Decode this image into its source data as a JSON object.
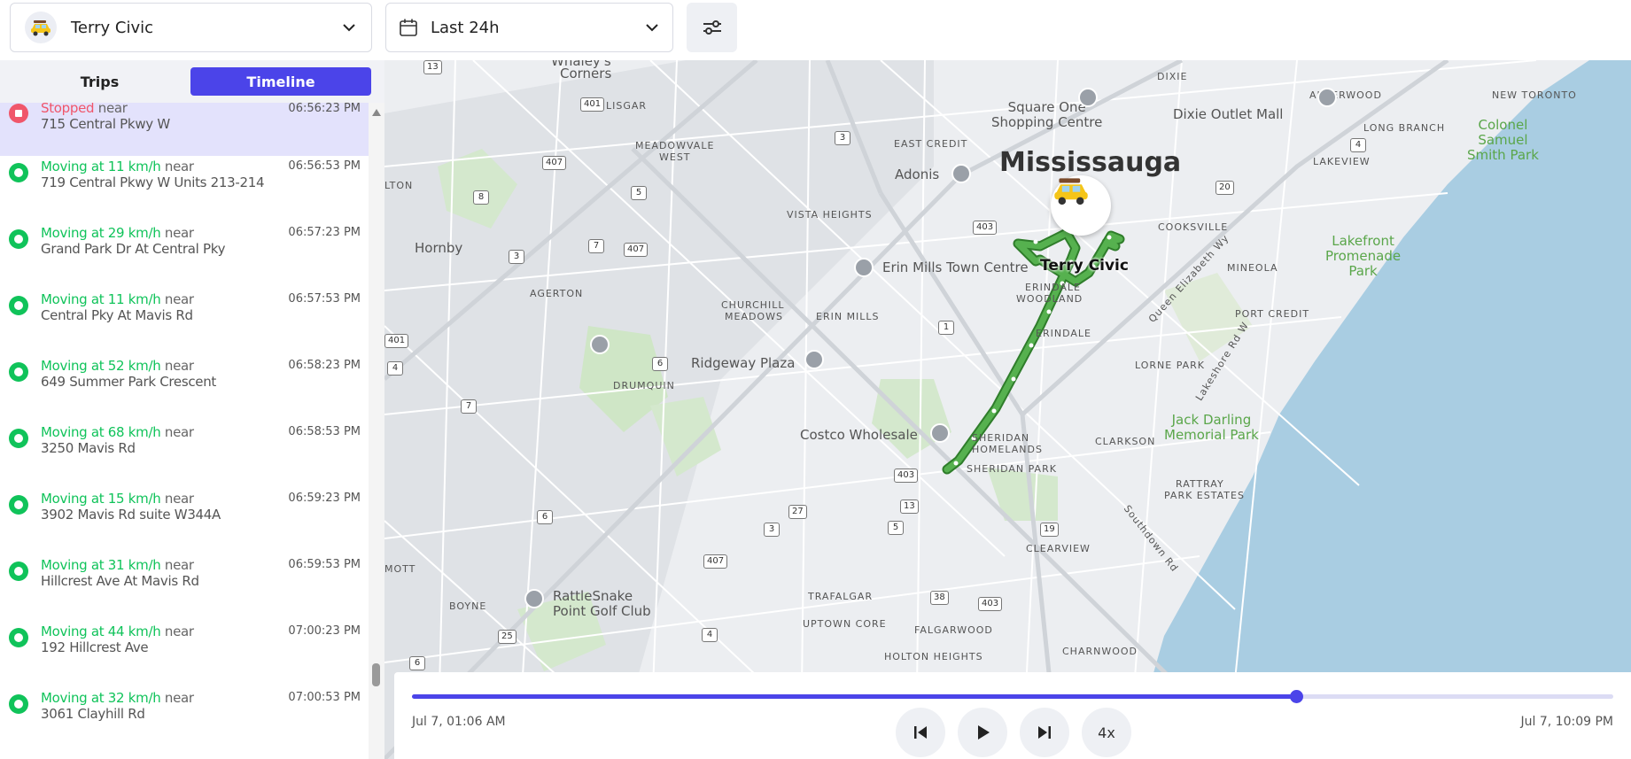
{
  "header": {
    "vehicle_name": "Terry Civic",
    "range_label": "Last 24h"
  },
  "tabs": [
    {
      "label": "Trips",
      "active": false
    },
    {
      "label": "Timeline",
      "active": true
    }
  ],
  "timeline": [
    {
      "state": "Stopped",
      "near": "near",
      "address": "715 Central Pkwy W",
      "time": "06:56:23 PM",
      "type": "stopped",
      "active": true
    },
    {
      "state": "Moving at 11 km/h",
      "near": "near",
      "address": "719 Central Pkwy W Units 213-214",
      "time": "06:56:53 PM",
      "type": "moving"
    },
    {
      "state": "Moving at 29 km/h",
      "near": "near",
      "address": "Grand Park Dr At Central Pky",
      "time": "06:57:23 PM",
      "type": "moving"
    },
    {
      "state": "Moving at 11 km/h",
      "near": "near",
      "address": "Central Pky At Mavis Rd",
      "time": "06:57:53 PM",
      "type": "moving"
    },
    {
      "state": "Moving at 52 km/h",
      "near": "near",
      "address": "649 Summer Park Crescent",
      "time": "06:58:23 PM",
      "type": "moving"
    },
    {
      "state": "Moving at 68 km/h",
      "near": "near",
      "address": "3250 Mavis Rd",
      "time": "06:58:53 PM",
      "type": "moving"
    },
    {
      "state": "Moving at 15 km/h",
      "near": "near",
      "address": "3902 Mavis Rd suite W344A",
      "time": "06:59:23 PM",
      "type": "moving"
    },
    {
      "state": "Moving at 31 km/h",
      "near": "near",
      "address": "Hillcrest Ave At Mavis Rd",
      "time": "06:59:53 PM",
      "type": "moving"
    },
    {
      "state": "Moving at 44 km/h",
      "near": "near",
      "address": "192 Hillcrest Ave",
      "time": "07:00:23 PM",
      "type": "moving"
    },
    {
      "state": "Moving at 32 km/h",
      "near": "near",
      "address": "3061 Clayhill Rd",
      "time": "07:00:53 PM",
      "type": "moving"
    }
  ],
  "map": {
    "city_label": "Mississauga",
    "vehicle_label": "Terry Civic",
    "labels": {
      "whaleys": "Whaley's",
      "corners": "Corners",
      "lisgar": "LISGAR",
      "meadowvale_west": "MEADOWVALE\nWEST",
      "east_credit": "EAST CREDIT",
      "square_one": "Square One\nShopping Centre",
      "dixie": "DIXIE",
      "dixie_outlet": "Dixie Outlet Mall",
      "alderwood": "ALDERWOOD",
      "new_toronto": "NEW TORONTO",
      "long_branch": "LONG BRANCH",
      "lakeview": "LAKEVIEW",
      "colonel_samuel": "Colonel\nSamuel\nSmith Park",
      "adonis": "Adonis",
      "vista_heights": "VISTA HEIGHTS",
      "cooksville": "COOKSVILLE",
      "hornby": "Hornby",
      "erin_mills_tc": "Erin Mills Town Centre",
      "erindale_woodland": "ERINDALE\nWOODLAND",
      "lakefront": "Lakefront\nPromenade\nPark",
      "mineola": "MINEOLA",
      "queen_elizabeth": "Queen Elizabeth Wy",
      "agerton": "AGERTON",
      "churchill_meadows": "CHURCHILL\nMEADOWS",
      "erin_mills": "ERIN MILLS",
      "erindale": "ERINDALE",
      "port_credit": "PORT CREDIT",
      "lorne_park": "LORNE PARK",
      "lakeshore": "Lakeshore Rd W",
      "ridgeway": "Ridgeway Plaza",
      "drumquin": "DRUMQUIN",
      "costco": "Costco Wholesale",
      "sheridan_homelands": "SHERIDAN\nHOMELANDS",
      "clarkson": "CLARKSON",
      "jack_darling": "Jack Darling\nMemorial Park",
      "sheridan_park": "SHERIDAN PARK",
      "rattray": "RATTRAY\nPARK ESTATES",
      "southdown": "Southdown Rd",
      "milton": "MOTT",
      "lton": "LTON",
      "boyne": "BOYNE",
      "rattlesnake": "RattleSnake\nPoint Golf Club",
      "clearview": "CLEARVIEW",
      "trafalgar": "TRAFALGAR",
      "uptown_core": "UPTOWN CORE",
      "falgarwood": "FALGARWOOD",
      "charnwood": "CHARNWOOD",
      "holton_heights": "HOLTON HEIGHTS"
    },
    "shields": [
      "13",
      "401",
      "3",
      "407",
      "5",
      "8",
      "20",
      "4",
      "403",
      "3",
      "7",
      "407",
      "401",
      "1",
      "6",
      "4",
      "7",
      "403",
      "13",
      "5",
      "27",
      "3",
      "6",
      "19",
      "407",
      "38",
      "403",
      "25",
      "4",
      "6"
    ]
  },
  "playback": {
    "start_label": "Jul 7, 01:06 AM",
    "end_label": "Jul 7, 10:09 PM",
    "progress": 0.736,
    "speed_label": "4x"
  },
  "colors": {
    "accent": "#4b44e9",
    "moving": "#10c35a",
    "stopped": "#f0566a",
    "route": "#3f9a3a",
    "water": "#a9cde2"
  },
  "icons": {
    "vehicle": "car-emoji-icon",
    "calendar": "calendar-icon",
    "filter": "sliders-icon",
    "prev": "skip-back-icon",
    "play": "play-icon",
    "next": "skip-forward-icon"
  }
}
